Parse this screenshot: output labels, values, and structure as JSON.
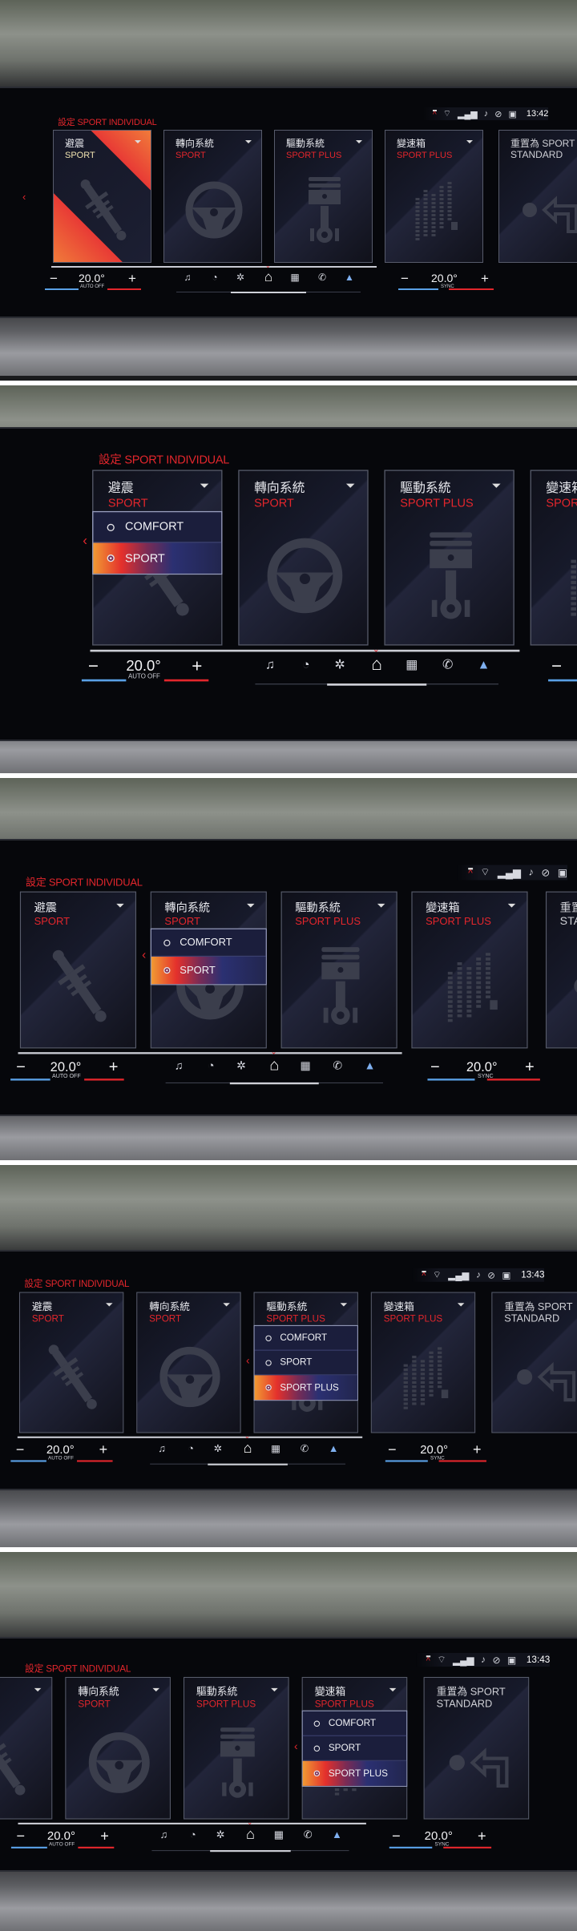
{
  "title": "設定 SPORT INDIVIDUAL",
  "accent_color": "#e3262c",
  "cards": [
    {
      "label": "避震",
      "value": "SPORT",
      "icon": "shock-absorber-icon"
    },
    {
      "label": "轉向系統",
      "value": "SPORT",
      "icon": "steering-wheel-icon"
    },
    {
      "label": "驅動系統",
      "value": "SPORT PLUS",
      "icon": "piston-icon"
    },
    {
      "label": "變速箱",
      "value": "SPORT PLUS",
      "icon": "gearbox-icon"
    },
    {
      "label": "重置為 SPORT STANDARD",
      "value": "",
      "icon": "reset-arrow-icon"
    }
  ],
  "climate": {
    "minus": "−",
    "plus": "+",
    "left_temp": "20.0°",
    "left_label": "AUTO OFF",
    "right_temp": "20.0°",
    "right_label": "SYNC"
  },
  "nav_icons": [
    "music-icon",
    "gauge-icon",
    "fan-icon",
    "home-icon",
    "apps-icon",
    "phone-icon",
    "navigation-icon"
  ],
  "nav_active": "home-icon",
  "status_icons": [
    "collapse-icon",
    "wifi-icon",
    "signal-icon",
    "notification-icon",
    "mute-icon",
    "profile-icon"
  ],
  "panels": [
    {
      "time": "13:42",
      "highlighted_card": 0,
      "popup": null
    },
    {
      "time": null,
      "highlighted_card": null,
      "popup": {
        "card": 0,
        "options": [
          "COMFORT",
          "SPORT"
        ],
        "selected": 1
      }
    },
    {
      "time": null,
      "highlighted_card": null,
      "popup": {
        "card": 1,
        "options": [
          "COMFORT",
          "SPORT"
        ],
        "selected": 1
      }
    },
    {
      "time": "13:43",
      "highlighted_card": null,
      "popup": {
        "card": 2,
        "options": [
          "COMFORT",
          "SPORT",
          "SPORT PLUS"
        ],
        "selected": 2
      }
    },
    {
      "time": "13:43",
      "highlighted_card": null,
      "popup": {
        "card": 3,
        "options": [
          "COMFORT",
          "SPORT",
          "SPORT PLUS"
        ],
        "selected": 2
      }
    }
  ]
}
